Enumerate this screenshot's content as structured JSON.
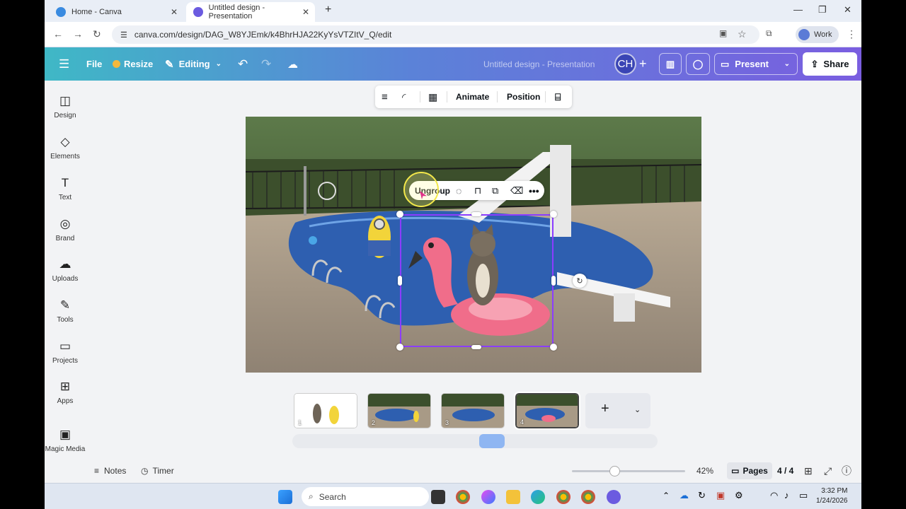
{
  "browser": {
    "tabs": [
      {
        "title": "Home - Canva",
        "active": false
      },
      {
        "title": "Untitled design - Presentation",
        "active": true
      }
    ],
    "url": "canva.com/design/DAG_W8YJEmk/k4BhrHJA22KyYsVTZItV_Q/edit",
    "profile_label": "Work"
  },
  "header": {
    "file_label": "File",
    "resize_label": "Resize",
    "editing_label": "Editing",
    "doc_title": "Untitled design - Presentation",
    "avatar_initials": "CH",
    "present_label": "Present",
    "share_label": "Share"
  },
  "rail": {
    "items": [
      {
        "label": "Design",
        "icon": "design-icon"
      },
      {
        "label": "Elements",
        "icon": "elements-icon"
      },
      {
        "label": "Text",
        "icon": "text-icon"
      },
      {
        "label": "Brand",
        "icon": "brand-icon"
      },
      {
        "label": "Uploads",
        "icon": "uploads-icon"
      },
      {
        "label": "Tools",
        "icon": "tools-icon"
      },
      {
        "label": "Projects",
        "icon": "projects-icon"
      },
      {
        "label": "Apps",
        "icon": "apps-icon"
      },
      {
        "label": "Magic Media",
        "icon": "magic-media-icon"
      }
    ]
  },
  "toolbar": {
    "animate_label": "Animate",
    "position_label": "Position"
  },
  "float_menu": {
    "ungroup_label": "Ungroup"
  },
  "pages": {
    "thumbs": [
      {
        "num": "1"
      },
      {
        "num": "2"
      },
      {
        "num": "3"
      },
      {
        "num": "4"
      }
    ]
  },
  "footer": {
    "notes_label": "Notes",
    "timer_label": "Timer",
    "zoom": "42%",
    "zoom_fraction": 0.42,
    "pages_label": "Pages",
    "page_counter": "4 / 4"
  },
  "taskbar": {
    "search_placeholder": "Search",
    "time": "3:32 PM",
    "date": "1/24/2026"
  },
  "colors": {
    "accent": "#8b3dff",
    "header_start": "#3fb8c6",
    "header_end": "#7a5ee0"
  }
}
